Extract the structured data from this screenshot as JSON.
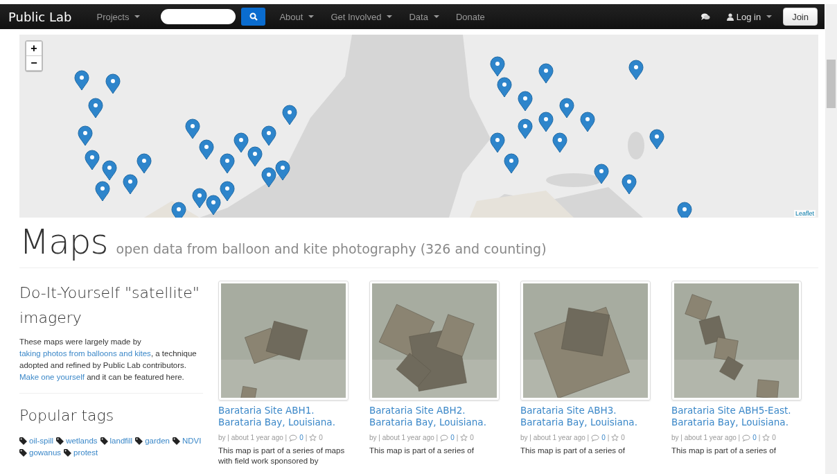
{
  "navbar": {
    "brand": "Public Lab",
    "items": [
      {
        "label": "Projects",
        "dropdown": true
      },
      {
        "kind": "search"
      },
      {
        "label": "About",
        "dropdown": true
      },
      {
        "label": "Get Involved",
        "dropdown": true
      },
      {
        "label": "Data",
        "dropdown": true
      },
      {
        "label": "Donate",
        "dropdown": false
      }
    ],
    "login": {
      "label": "Log in",
      "dropdown": true
    },
    "join": "Join"
  },
  "map": {
    "kind": "picture",
    "zoom_in": "+",
    "zoom_out": "−",
    "attribution": "Leaflet"
  },
  "header": {
    "title": "Maps",
    "subtitle": "open data from balloon and kite photography (326 and counting)"
  },
  "intro": {
    "title": "Do-It-Yourself \"satellite\" imagery",
    "text": [
      {
        "text": "These maps were largely made by ",
        "link": false
      },
      {
        "text": "taking photos from balloons and kites",
        "link": true
      },
      {
        "text": ", a technique adopted and refined by Public Lab contributors. ",
        "link": false
      },
      {
        "text": "Make one yourself",
        "link": true
      },
      {
        "text": " and it can be featured here.",
        "link": false
      }
    ]
  },
  "tags": {
    "title": "Popular tags",
    "items": [
      "oil-spill",
      "wetlands",
      "landfill",
      "garden",
      "NDVI",
      "gowanus",
      "protest"
    ]
  },
  "maps": [
    {
      "title": "Barataria Site ABH1. Barataria Bay, Louisiana.",
      "meta": "by | about 1 year ago |",
      "comments": "0",
      "likes": "0",
      "description": "This map is part of a series of maps with field work sponsored by"
    },
    {
      "title": "Barataria Site ABH2. Barataria Bay, Louisiana.",
      "meta": "by | about 1 year ago |",
      "comments": "0",
      "likes": "0",
      "description": "This map is part of a series of"
    },
    {
      "title": "Barataria Site ABH3. Barataria Bay, Louisiana.",
      "meta": "by | about 1 year ago |",
      "comments": "0",
      "likes": "0",
      "description": "This map is part of a series of"
    },
    {
      "title": "Barataria Site ABH5-East. Barataria Bay, Louisiana.",
      "meta": "by | about 1 year ago |",
      "comments": "0",
      "likes": "0",
      "description": "This map is part of a series of"
    }
  ],
  "meta_separator": "|"
}
